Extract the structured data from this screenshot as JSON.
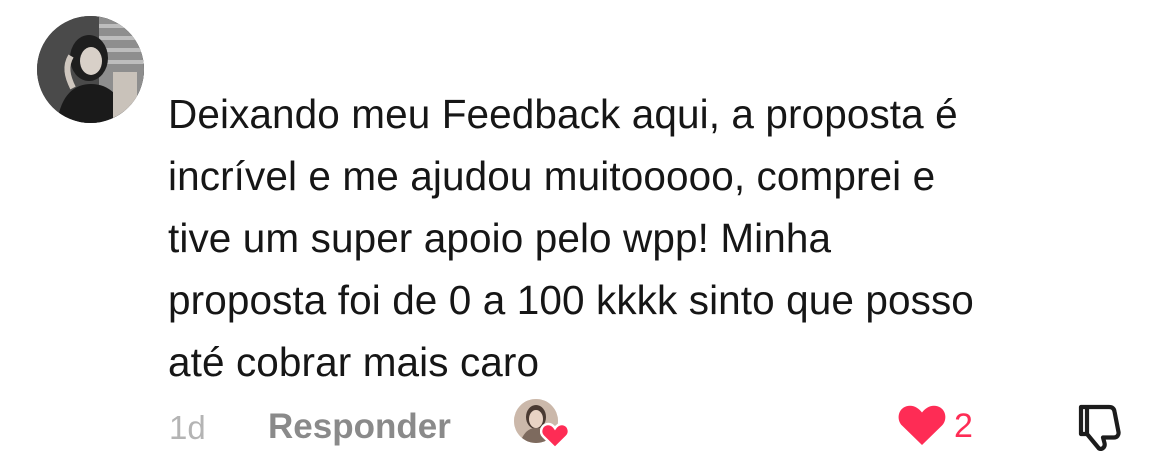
{
  "comment": {
    "avatar_icon": "user-avatar",
    "text": "Deixando meu Feedback aqui, a proposta é\nincrível e me ajudou muitooooo, comprei e\ntive um super apoio pelo wpp! Minha\nproposta foi de 0 a 100 kkkk sinto que posso\naté cobrar mais caro"
  },
  "actions": {
    "time": "1d",
    "reply_label": "Responder",
    "creator_liked_icon": "creator-avatar-heart",
    "like_icon": "heart-icon",
    "like_count": "2",
    "dislike_icon": "thumbs-down-icon"
  },
  "colors": {
    "text": "#161616",
    "muted": "#b4b4b4",
    "reply": "#8a8a8a",
    "like": "#fe2c55"
  }
}
